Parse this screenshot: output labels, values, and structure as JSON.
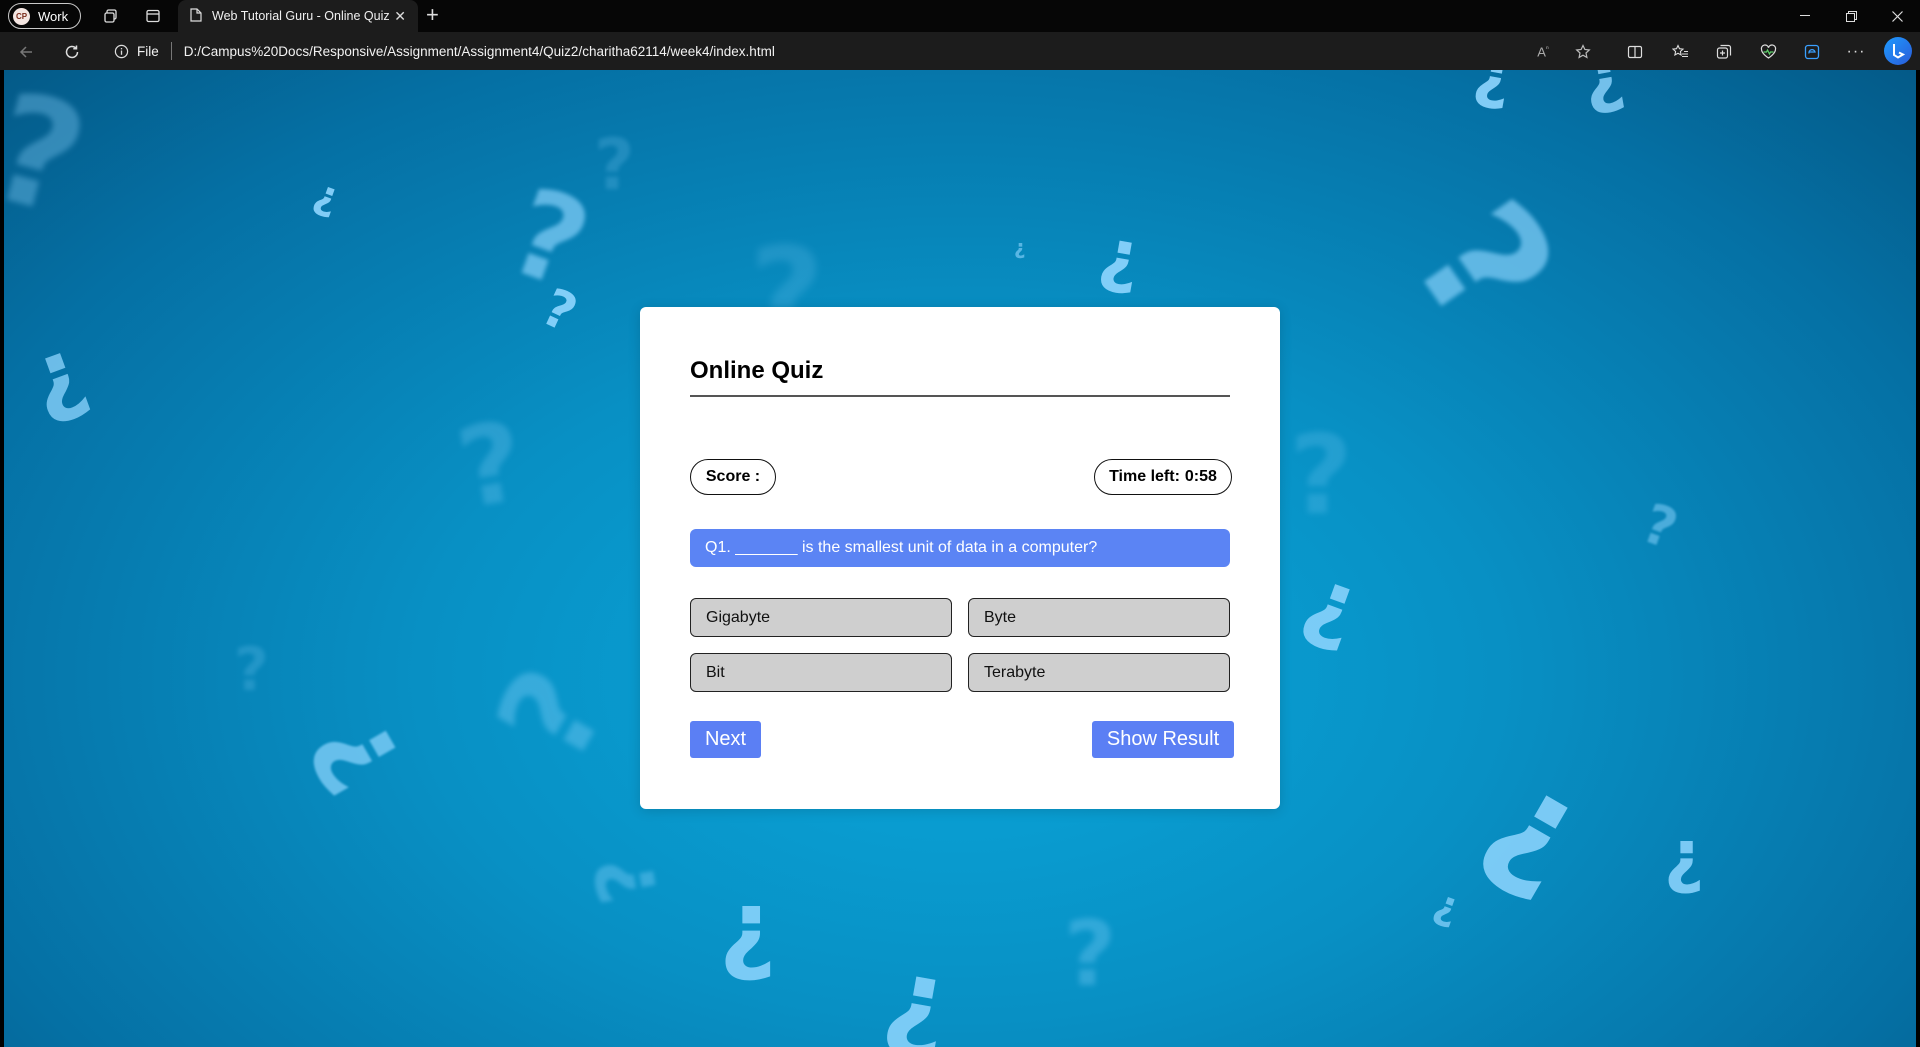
{
  "browser": {
    "profile_initials": "CP",
    "profile_label": "Work",
    "tab_title": "Web Tutorial Guru - Online Quiz",
    "url_scheme_label": "File",
    "url": "D:/Campus%20Docs/Responsive/Assignment/Assignment4/Quiz2/charitha62114/week4/index.html"
  },
  "quiz": {
    "title": "Online Quiz",
    "score_label": "Score :",
    "time_label": "Time left:",
    "time_value": "0:58",
    "question": "Q1. _______ is the smallest unit of data in a computer?",
    "options": [
      "Gigabyte",
      "Byte",
      "Bit",
      "Terabyte"
    ],
    "next_label": "Next",
    "result_label": "Show Result"
  },
  "colors": {
    "accent": "#5b84f4",
    "background": "#0890c4",
    "option_bg": "#cfcfcf"
  }
}
